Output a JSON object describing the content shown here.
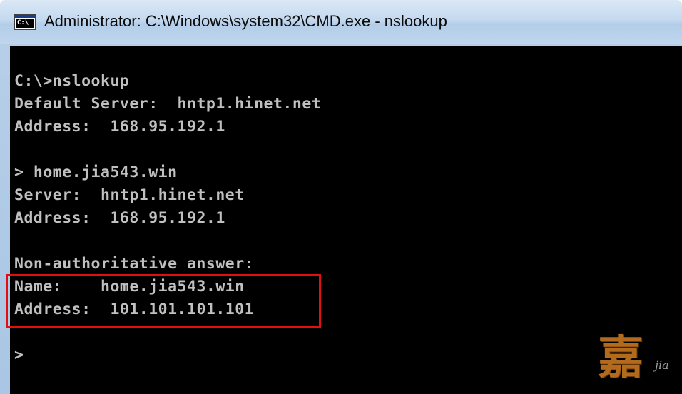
{
  "window": {
    "title": "Administrator: C:\\Windows\\system32\\CMD.exe - nslookup",
    "icon": "cmd-icon",
    "icon_glyph": "C:\\"
  },
  "console": {
    "lines": [
      "",
      "C:\\>nslookup",
      "Default Server:  hntp1.hinet.net",
      "Address:  168.95.192.1",
      "",
      "> home.jia543.win",
      "Server:  hntp1.hinet.net",
      "Address:  168.95.192.1",
      "",
      "Non-authoritative answer:",
      "Name:    home.jia543.win",
      "Address:  101.101.101.101",
      "",
      ">"
    ],
    "highlight_color": "#e01010"
  },
  "watermark": {
    "char": "嘉",
    "sub": "jia"
  }
}
